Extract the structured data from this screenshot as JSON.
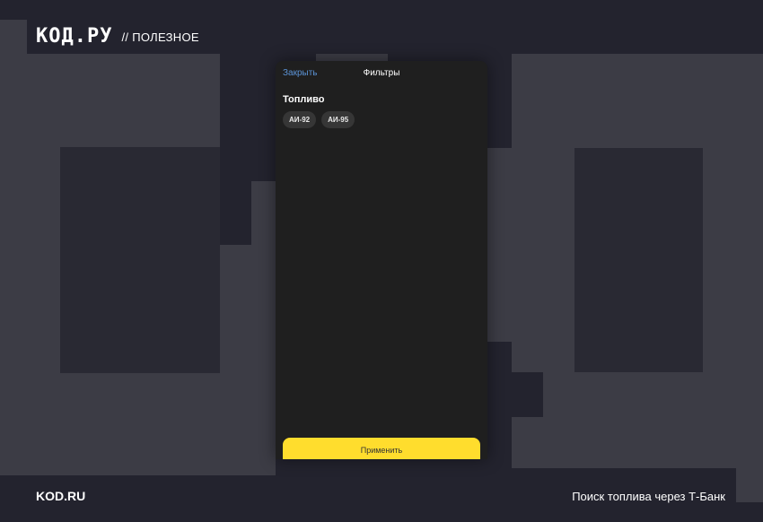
{
  "header": {
    "logo": "КОД.РУ",
    "section": "// ПОЛЕЗНОЕ"
  },
  "footer": {
    "left": "KOD.RU",
    "right": "Поиск топлива через Т-Банк"
  },
  "filters": {
    "close_label": "Закрыть",
    "title": "Фильтры",
    "fuel_heading": "Топливо",
    "chips": [
      {
        "label": "АИ-92"
      },
      {
        "label": "АИ-95"
      }
    ],
    "apply_label": "Применить"
  },
  "colors": {
    "accent_yellow": "#ffdd2d",
    "link_blue": "#5b93d6",
    "background": "#23232e"
  }
}
